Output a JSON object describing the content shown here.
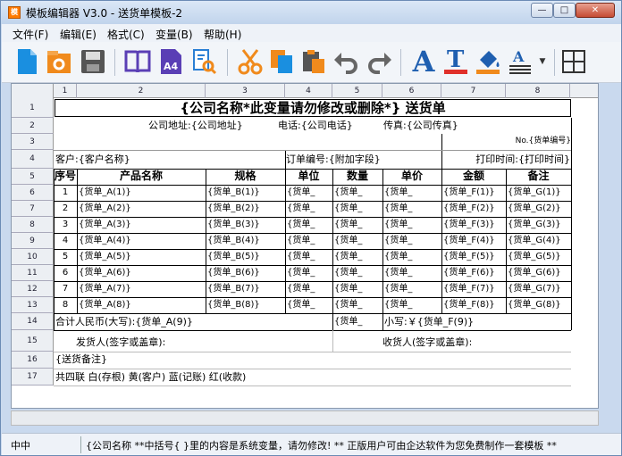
{
  "window": {
    "title": "模板编辑器 V3.0 - 送货单模板-2",
    "min": "—",
    "max": "□",
    "close": "✕",
    "icon_text": "模"
  },
  "menu": [
    "文件(F)",
    "编辑(E)",
    "格式(C)",
    "变量(B)",
    "帮助(H)"
  ],
  "toolbar": {
    "icons": [
      "new-file-icon",
      "open-folder-icon",
      "save-icon",
      "book-icon",
      "page-size-a4-icon",
      "print-preview-icon",
      "cut-icon",
      "copy-icon",
      "paste-icon",
      "undo-icon",
      "redo-icon",
      "font-icon",
      "text-color-icon",
      "fill-color-icon",
      "line-spacing-icon",
      "border-grid-icon"
    ],
    "a4_label": "A4",
    "font_label": "A",
    "text_color_label": "T"
  },
  "sheet": {
    "columns": [
      "1",
      "2",
      "3",
      "4",
      "5",
      "6",
      "7",
      "8"
    ],
    "rows": [
      "1",
      "2",
      "3",
      "4",
      "5",
      "6",
      "7",
      "8",
      "9",
      "10",
      "11",
      "12",
      "13",
      "14",
      "15",
      "16",
      "17"
    ],
    "title": "{公司名称*此变量请勿修改或删除*} 送货单",
    "address": "公司地址:{公司地址}",
    "phone": "电话:{公司电话}",
    "fax": "传真:{公司传真}",
    "number": "No.{货单编号}",
    "customer": "客户:{客户名称}",
    "order_no": "订单编号:{附加字段}",
    "print_time": "打印时间:{打印时间}",
    "headers": [
      "序号",
      "产品名称",
      "规格",
      "单位",
      "数量",
      "单价",
      "金额",
      "备注"
    ],
    "items": [
      {
        "no": "1",
        "a": "{货单_A(1)}",
        "b": "{货单_B(1)}",
        "c": "{货单_",
        "d": "{货单_",
        "e": "{货单_",
        "f": "{货单_F(1)}",
        "g": "{货单_G(1)}"
      },
      {
        "no": "2",
        "a": "{货单_A(2)}",
        "b": "{货单_B(2)}",
        "c": "{货单_",
        "d": "{货单_",
        "e": "{货单_",
        "f": "{货单_F(2)}",
        "g": "{货单_G(2)}"
      },
      {
        "no": "3",
        "a": "{货单_A(3)}",
        "b": "{货单_B(3)}",
        "c": "{货单_",
        "d": "{货单_",
        "e": "{货单_",
        "f": "{货单_F(3)}",
        "g": "{货单_G(3)}"
      },
      {
        "no": "4",
        "a": "{货单_A(4)}",
        "b": "{货单_B(4)}",
        "c": "{货单_",
        "d": "{货单_",
        "e": "{货单_",
        "f": "{货单_F(4)}",
        "g": "{货单_G(4)}"
      },
      {
        "no": "5",
        "a": "{货单_A(5)}",
        "b": "{货单_B(5)}",
        "c": "{货单_",
        "d": "{货单_",
        "e": "{货单_",
        "f": "{货单_F(5)}",
        "g": "{货单_G(5)}"
      },
      {
        "no": "6",
        "a": "{货单_A(6)}",
        "b": "{货单_B(6)}",
        "c": "{货单_",
        "d": "{货单_",
        "e": "{货单_",
        "f": "{货单_F(6)}",
        "g": "{货单_G(6)}"
      },
      {
        "no": "7",
        "a": "{货单_A(7)}",
        "b": "{货单_B(7)}",
        "c": "{货单_",
        "d": "{货单_",
        "e": "{货单_",
        "f": "{货单_F(7)}",
        "g": "{货单_G(7)}"
      },
      {
        "no": "8",
        "a": "{货单_A(8)}",
        "b": "{货单_B(8)}",
        "c": "{货单_",
        "d": "{货单_",
        "e": "{货单_",
        "f": "{货单_F(8)}",
        "g": "{货单_G(8)}"
      }
    ],
    "total_upper": "合计人民币(大写):{货单_A(9)}",
    "total_qty": "{货单_",
    "total_lower": "小写:￥{货单_F(9)}",
    "sender": "发货人(签字或盖章):",
    "receiver": "收货人(签字或盖章):",
    "remark": "{送货备注}",
    "footer": "共四联 白(存根) 黄(客户) 蓝(记账) 红(收款)"
  },
  "status": {
    "left": "中中",
    "message": "{公司名称 **中括号{ }里的内容是系统变量，请勿修改! ** 正版用户可由企达软件为您免费制作一套模板 **"
  }
}
